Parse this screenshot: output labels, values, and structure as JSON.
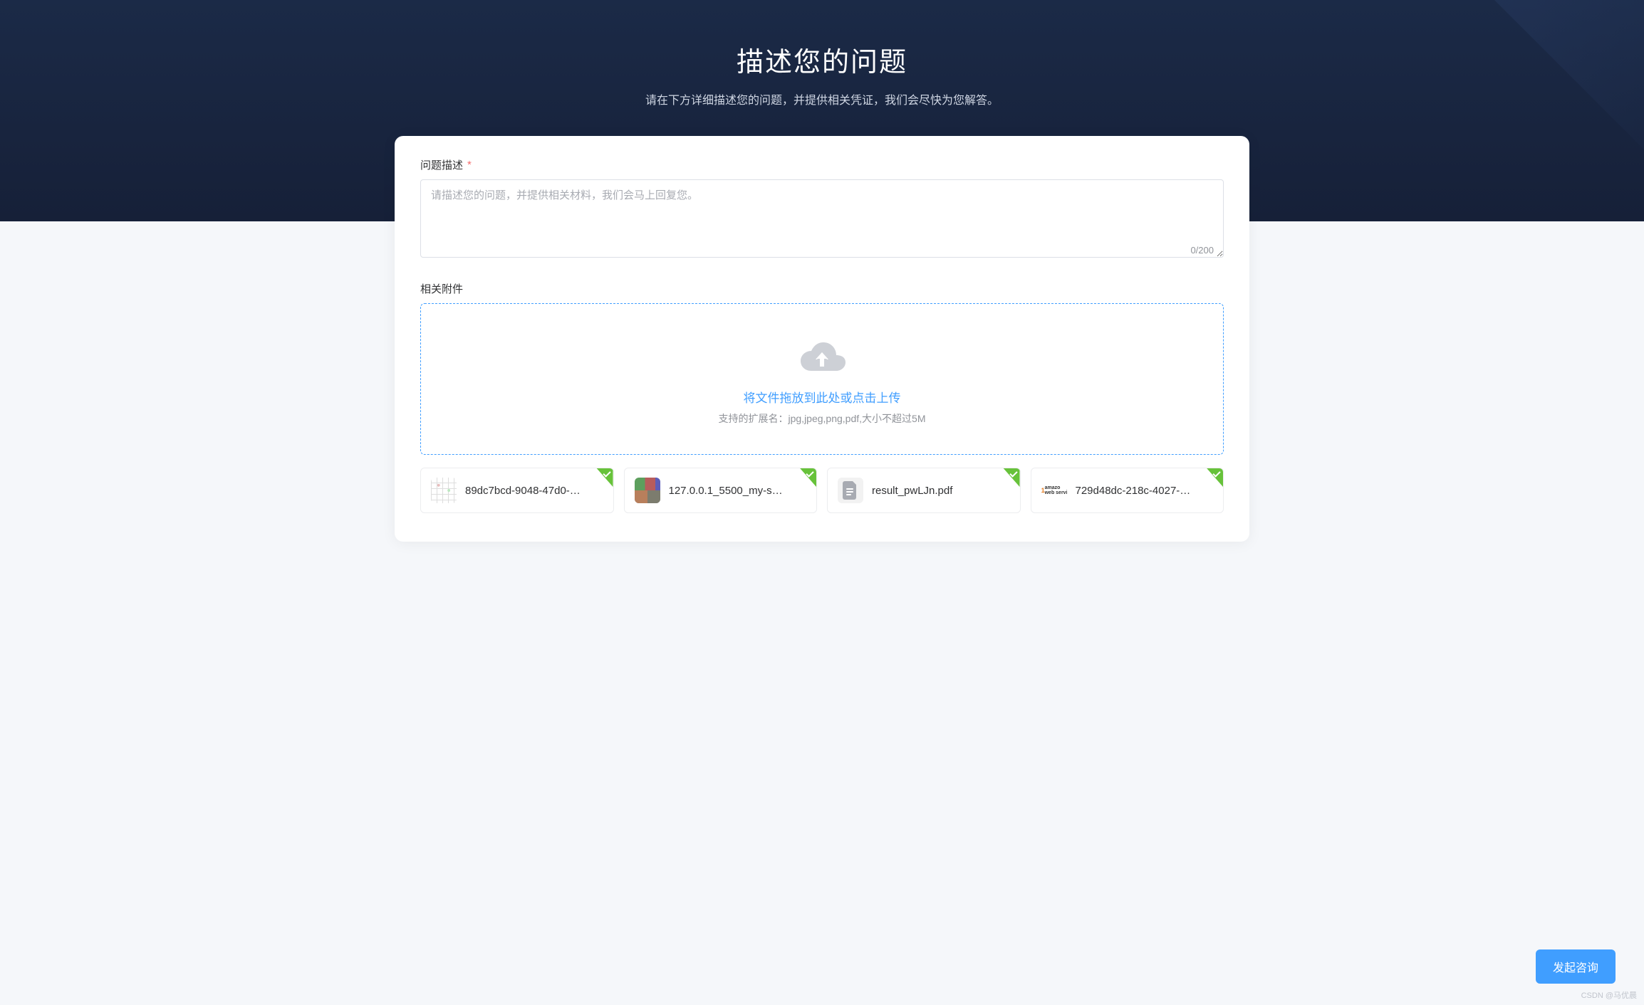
{
  "hero": {
    "title": "描述您的问题",
    "subtitle": "请在下方详细描述您的问题，并提供相关凭证，我们会尽快为您解答。"
  },
  "form": {
    "desc_label": "问题描述",
    "desc_required": "*",
    "desc_placeholder": "请描述您的问题，并提供相关材料，我们会马上回复您。",
    "desc_counter": "0/200",
    "attach_label": "相关附件",
    "upload_link_text": "将文件拖放到此处或点击上传",
    "upload_hint": "支持的扩展名：jpg,jpeg,png,pdf,大小不超过5M"
  },
  "files": [
    {
      "name": "89dc7bcd-9048-47d0-…",
      "thumb": "a"
    },
    {
      "name": "127.0.0.1_5500_my-s…",
      "thumb": "b"
    },
    {
      "name": "result_pwLJn.pdf",
      "thumb": "c"
    },
    {
      "name": "729d48dc-218c-4027-…",
      "thumb": "d"
    }
  ],
  "submit_label": "发起咨询",
  "watermark": "CSDN @马优晨"
}
